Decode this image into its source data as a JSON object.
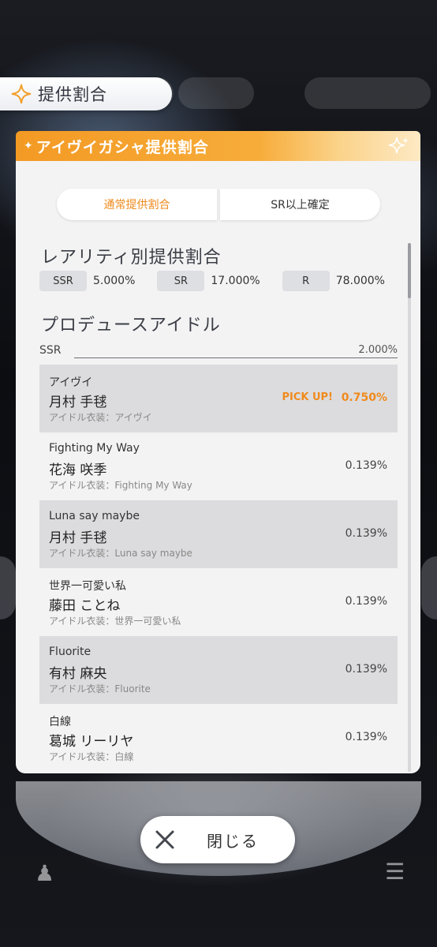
{
  "header": {
    "title": "提供割合"
  },
  "dialog": {
    "title": "アイヴイガシャ提供割合",
    "tabs": [
      {
        "label": "通常提供割合"
      },
      {
        "label": "SR以上確定"
      }
    ],
    "rarity_section": {
      "title": "レアリティ別提供割合",
      "rates": [
        {
          "label": "SSR",
          "value": "5.000%"
        },
        {
          "label": "SR",
          "value": "17.000%"
        },
        {
          "label": "R",
          "value": "78.000%"
        }
      ]
    },
    "idol_section": {
      "title": "プロデュースアイドル",
      "group_label": "SSR",
      "group_rate": "2.000%",
      "items": [
        {
          "song": "アイヴイ",
          "name": "月村 手毬",
          "costume": "アイドル衣装：アイヴイ",
          "pickup": "PICK UP!",
          "rate": "0.750%"
        },
        {
          "song": "Fighting My Way",
          "name": "花海 咲季",
          "costume": "アイドル衣装：Fighting My Way",
          "rate": "0.139%"
        },
        {
          "song": "Luna say maybe",
          "name": "月村 手毬",
          "costume": "アイドル衣装：Luna say maybe",
          "rate": "0.139%"
        },
        {
          "song": "世界一可愛い私",
          "name": "藤田 ことね",
          "costume": "アイドル衣装：世界一可愛い私",
          "rate": "0.139%"
        },
        {
          "song": "Fluorite",
          "name": "有村 麻央",
          "costume": "アイドル衣装：Fluorite",
          "rate": "0.139%"
        },
        {
          "song": "白線",
          "name": "葛城 リーリヤ",
          "costume": "アイドル衣装：白線",
          "rate": "0.139%"
        }
      ]
    }
  },
  "footer": {
    "close_label": "閉じる"
  },
  "colors": {
    "accent": "#f08a1c",
    "header_band": "#f5a331"
  }
}
